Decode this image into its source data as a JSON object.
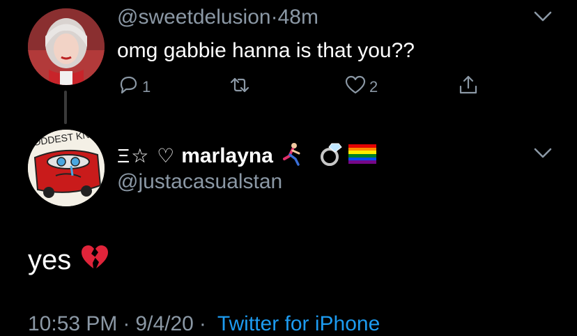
{
  "tweet": {
    "handle": "@sweetdelusion",
    "dot": "·",
    "time": "48m",
    "text": "omg gabbie hanna is that you??",
    "reply_count": "1",
    "like_count": "2"
  },
  "reply": {
    "name_prefix": "Ξ☆ ♡",
    "name": "marlayna",
    "handle": "@justacasualstan",
    "avatar_text": "ODDEST KNOW",
    "text": "yes",
    "timestamp": "10:53 PM",
    "date": "9/4/20",
    "sep1": "·",
    "sep2": "·",
    "source": "Twitter for iPhone"
  },
  "icons": {
    "reply": "reply-icon",
    "retweet": "retweet-icon",
    "like": "heart-icon",
    "share": "share-icon",
    "more": "chevron-down-icon"
  },
  "colors": {
    "background": "#000000",
    "muted": "#8b98a5",
    "link": "#1d9bf0"
  }
}
